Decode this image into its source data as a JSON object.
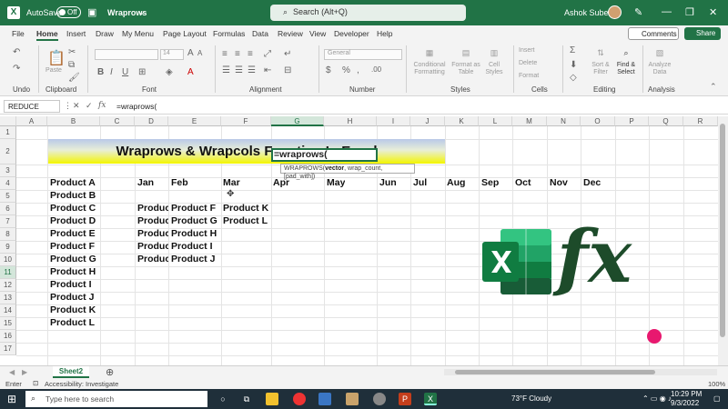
{
  "titlebar": {
    "autosave_label": "AutoSave",
    "autosave_state": "Off",
    "file_name": "Wraprows",
    "search_placeholder": "Search (Alt+Q)",
    "user_name": "Ashok Subedi",
    "excel_icon": "X"
  },
  "menu": {
    "items": [
      "File",
      "Home",
      "Insert",
      "Draw",
      "My Menu",
      "Page Layout",
      "Formulas",
      "Data",
      "Review",
      "View",
      "Developer",
      "Help"
    ],
    "active": "Home",
    "comments": "Comments",
    "share": "Share"
  },
  "ribbon": {
    "groups": [
      "Undo",
      "Clipboard",
      "Font",
      "Alignment",
      "Number",
      "Styles",
      "Cells",
      "Editing",
      "Analysis"
    ],
    "font_size": "14",
    "number_format": "General",
    "styles": [
      "Conditional Formatting",
      "Format as Table",
      "Cell Styles"
    ],
    "cells": [
      "Insert",
      "Delete",
      "Format"
    ],
    "editing": [
      "Sort & Filter",
      "Find & Select"
    ],
    "analysis": "Analyze Data",
    "paste": "Paste"
  },
  "formula_bar": {
    "name_box": "REDUCE",
    "formula": "=wraprows("
  },
  "columns": [
    "A",
    "B",
    "C",
    "D",
    "E",
    "F",
    "G",
    "H",
    "I",
    "J",
    "K",
    "L",
    "M",
    "N",
    "O",
    "P",
    "Q",
    "R"
  ],
  "rows": [
    "1",
    "2",
    "3",
    "4",
    "5",
    "6",
    "7",
    "8",
    "9",
    "10",
    "11",
    "12",
    "13",
    "14",
    "15",
    "16",
    "17"
  ],
  "selected_column": "G",
  "selected_row": "11",
  "sheet": {
    "title": "Wraprows & Wrapcols Function In Excel",
    "products": [
      "Product A",
      "Product B",
      "Product C",
      "Product D",
      "Product E",
      "Product F",
      "Product G",
      "Product H",
      "Product I",
      "Product J",
      "Product K",
      "Product L"
    ],
    "months": [
      "Jan",
      "Feb",
      "Mar",
      "Apr",
      "May",
      "Jun",
      "Jul",
      "Aug",
      "Sep",
      "Oct",
      "Nov",
      "Dec"
    ],
    "col_d": [
      "Produc",
      "Produc",
      "Produc",
      "Produc",
      "Produc"
    ],
    "col_e": [
      "Product F",
      "Product G",
      "Product H",
      "Product I",
      "Product J"
    ],
    "col_f": [
      "Product K",
      "Product L"
    ],
    "active_cell_text": "=wraprows(",
    "tooltip_fn": "WRAPROWS(",
    "tooltip_args": "vector",
    "tooltip_rest": ", wrap_count, [pad_with])"
  },
  "fx_label": "fx",
  "sheet_tab": "Sheet2",
  "status": {
    "mode": "Enter",
    "accessibility": "Accessibility: Investigate",
    "zoom": "100%"
  },
  "taskbar": {
    "search_placeholder": "Type here to search",
    "weather": "73°F Cloudy",
    "time": "10:29 PM",
    "date": "9/3/2022"
  },
  "colors": {
    "accent": "#217346",
    "highlight": "#e8186f"
  }
}
